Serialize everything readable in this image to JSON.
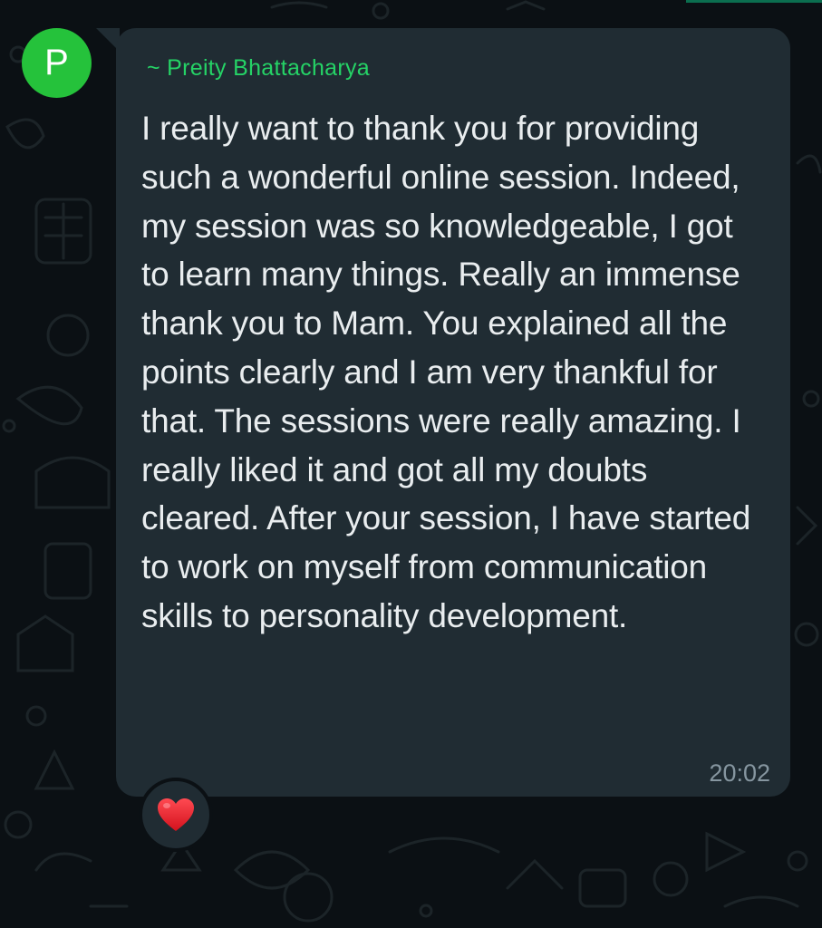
{
  "chat": {
    "avatar_initial": "P",
    "sender": "~ Preity Bhattacharya",
    "message": "I really want to thank you for providing such a wonderful online session. Indeed, my session was so knowledgeable, I got to learn many things. Really an immense thank you to Mam. You explained all the points clearly and I am very thankful for that. The sessions were really amazing. I really liked it and got all my doubts cleared. After your session, I have started to work on myself from communication skills to personality development.",
    "time": "20:02",
    "reaction_icon": "red-heart-icon"
  },
  "colors": {
    "background": "#0b1014",
    "bubble": "#202c33",
    "avatar": "#25c23b",
    "sender_name": "#25d366",
    "message_text": "#e9edef",
    "timestamp": "#8696a0",
    "heart": "#e0202e"
  }
}
